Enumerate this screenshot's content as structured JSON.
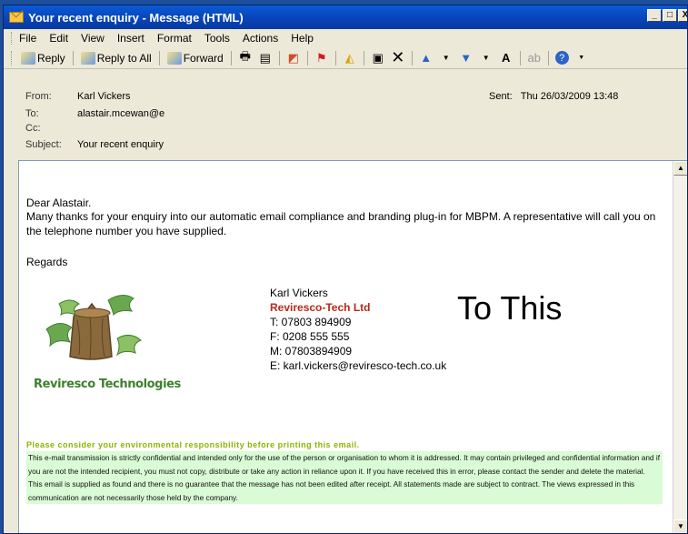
{
  "window": {
    "title": "Your recent enquiry - Message (HTML)",
    "controls": [
      "_",
      "□",
      "X"
    ]
  },
  "menu": [
    "File",
    "Edit",
    "View",
    "Insert",
    "Format",
    "Tools",
    "Actions",
    "Help"
  ],
  "toolbar": {
    "reply": "Reply",
    "reply_all": "Reply to All",
    "forward": "Forward"
  },
  "header": {
    "from_label": "From:",
    "from": "Karl Vickers",
    "to_label": "To:",
    "to": "alastair.mcewan@e",
    "cc_label": "Cc:",
    "cc": "",
    "subject_label": "Subject:",
    "subject": "Your recent enquiry",
    "sent_label": "Sent:",
    "sent": "Thu 26/03/2009 13:48"
  },
  "body": {
    "greeting": "Dear Alastair.",
    "paragraph": "Many thanks for your enquiry into our automatic email compliance and branding plug-in for MBPM. A representative will call you on the telephone number you have supplied.",
    "regards": "Regards",
    "logo_text": "Reviresco Technologies",
    "signature": {
      "name": "Karl Vickers",
      "company": "Reviresco-Tech Ltd",
      "tel": "T: 07803 894909",
      "fax": "F: 0208 555 555",
      "mobile": "M: 07803894909",
      "email": "E: karl.vickers@reviresco-tech.co.uk"
    },
    "annotation": "To This",
    "env_notice": "Please consider your environmental responsibility before printing this email.",
    "disclaimer": "This e-mail transmission is strictly confidential and intended only for the use of the person or organisation to whom it is addressed. It may contain privileged and confidential information and if you are not the intended recipient, you must not copy, distribute or take any action in reliance upon it. If you have received this in error, please contact the sender and delete the material. This email is supplied as found and there is no guarantee that the message has not been edited after receipt. All statements made are subject to contract. The views expressed in this communication are not necessarily those held by the company."
  },
  "colors": {
    "titlebar": "#0843b5",
    "company": "#b52a1c",
    "env_notice": "#8cb400",
    "disclaimer_bg": "#d9fbd5"
  }
}
